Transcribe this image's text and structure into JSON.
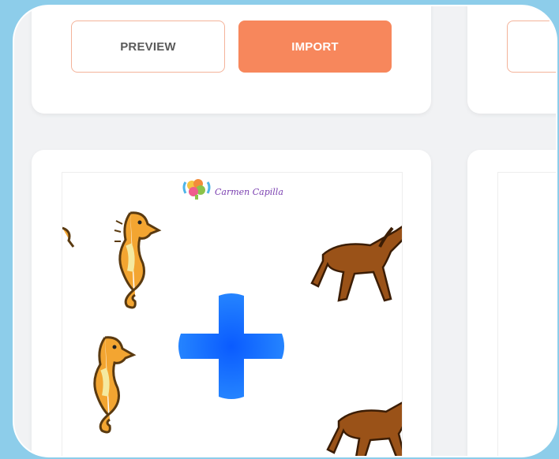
{
  "left_card": {
    "preview_label": "PREVIEW",
    "import_label": "IMPORT"
  },
  "thumbnail": {
    "watermark": "Carmen Capilla"
  },
  "colors": {
    "accent": "#f7875c",
    "outline": "#f4b39a",
    "background": "#8dcdea"
  },
  "icons": [
    "seahorse-icon",
    "plus-icon",
    "horse-icon"
  ]
}
